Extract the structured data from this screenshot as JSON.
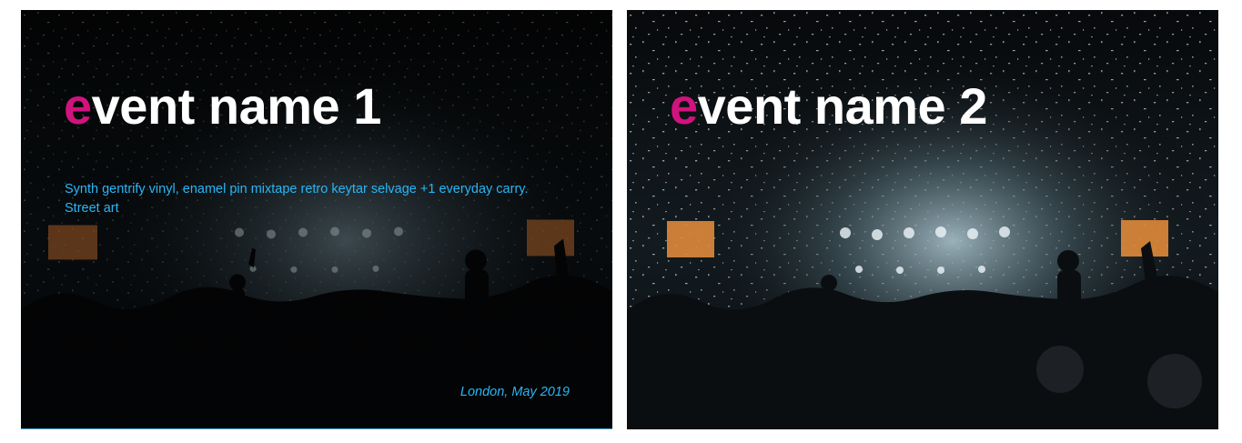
{
  "theme": {
    "accent_color": "#d1137e",
    "info_color": "#29b6f6",
    "title_color": "#ffffff"
  },
  "cards": [
    {
      "title_first_letter": "e",
      "title_rest": "vent name 1",
      "description": "Synth gentrify vinyl, enamel pin mixtape retro keytar selvage +1 everyday carry. Street art",
      "meta": "London, May 2019",
      "image_icon": "concert-crowd-image",
      "dimmed": true
    },
    {
      "title_first_letter": "e",
      "title_rest": "vent name 2",
      "image_icon": "concert-crowd-image",
      "dimmed": false
    }
  ]
}
